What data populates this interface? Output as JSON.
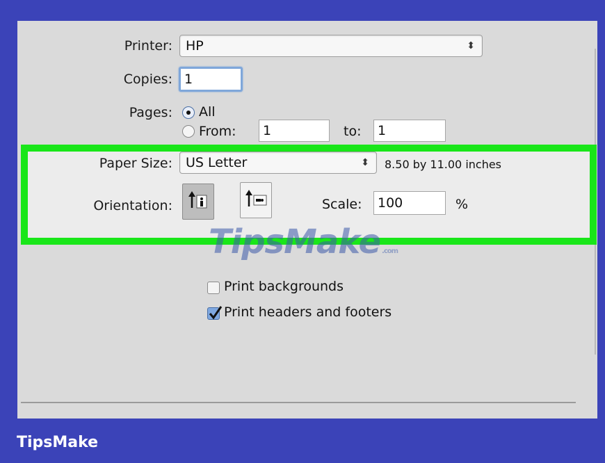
{
  "print_dialog": {
    "printer": {
      "label": "Printer:",
      "value": "HP"
    },
    "copies": {
      "label": "Copies:",
      "value": "1"
    },
    "pages": {
      "label": "Pages:",
      "option_all": "All",
      "option_from": "From:",
      "from_value": "1",
      "to_label": "to:",
      "to_value": "1",
      "selected": "All"
    },
    "paper_size": {
      "label": "Paper Size:",
      "value": "US Letter",
      "dimensions": "8.50 by 11.00 inches"
    },
    "orientation": {
      "label": "Orientation:",
      "selected": "portrait"
    },
    "scale": {
      "label": "Scale:",
      "value": "100",
      "unit": "%"
    },
    "options": {
      "print_backgrounds": {
        "label": "Print backgrounds",
        "checked": false
      },
      "print_headers_footers": {
        "label": "Print headers and footers",
        "checked": true
      }
    }
  },
  "watermark": {
    "text": "TipsMake",
    "suffix": ".com"
  },
  "footer": {
    "brand": "TipsMake"
  },
  "colors": {
    "highlight": "#19e619",
    "frame": "#3b43b8",
    "dialog": "#dadada"
  }
}
